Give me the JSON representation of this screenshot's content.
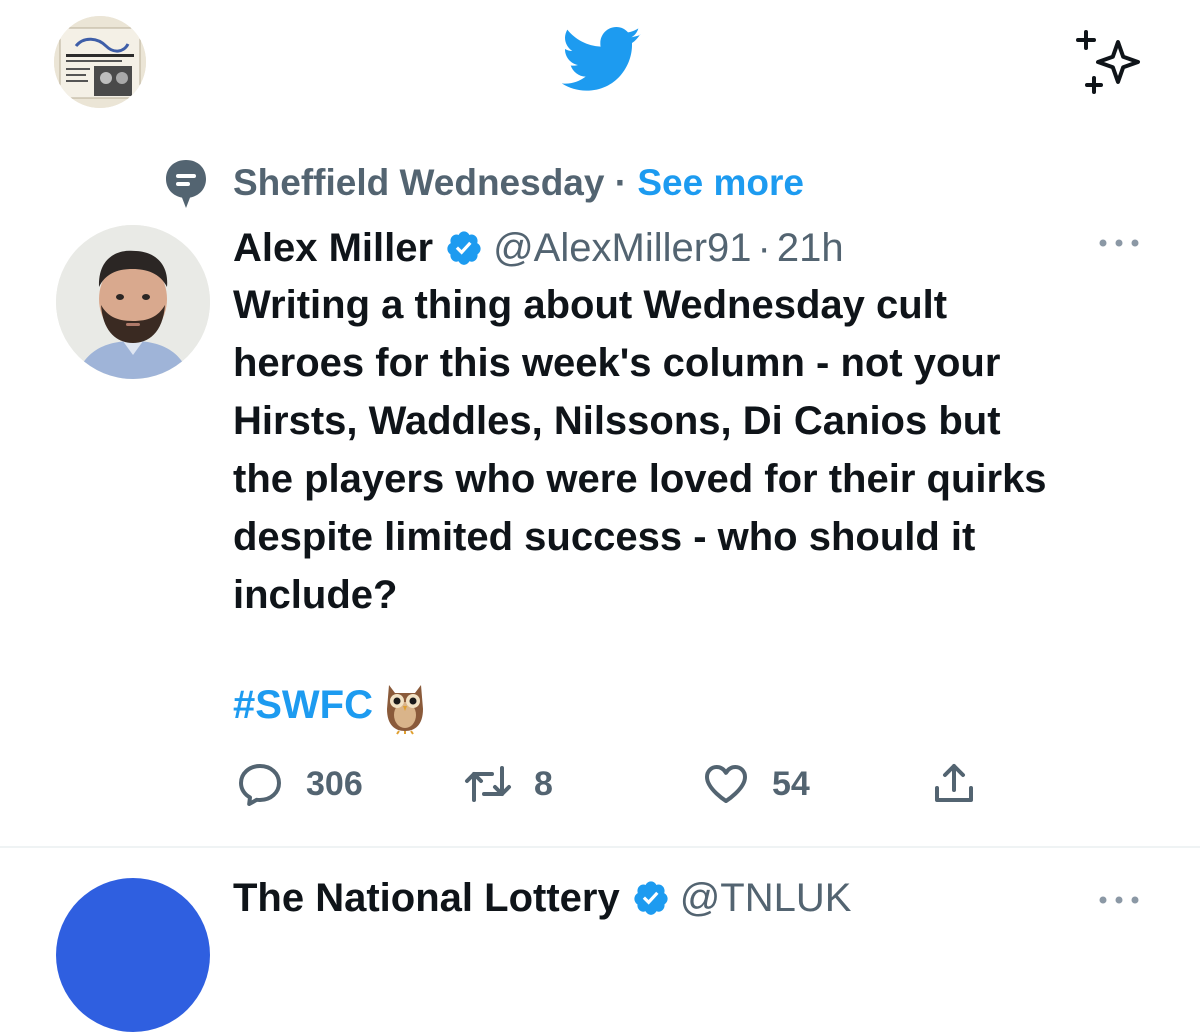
{
  "header": {
    "profile_icon": "user-profile-thumbnail",
    "logo_icon": "twitter-bird-icon",
    "timeline_icon": "sparkle-icon"
  },
  "context": {
    "topic": "Sheffield Wednesday",
    "separator": "·",
    "link": "See more"
  },
  "tweet": {
    "author_name": "Alex Miller",
    "handle": "@AlexMiller91",
    "separator": "·",
    "time": "21h",
    "text": "Writing a thing about Wednesday cult\nheroes for this week's column - not your\nHirsts, Waddles, Nilssons, Di Canios but\nthe players who were loved for their quirks\ndespite limited success - who should it\ninclude?",
    "hashtag": "#SWFC",
    "emoji": "owl-emoji",
    "replies": "306",
    "retweets": "8",
    "likes": "54"
  },
  "next_tweet": {
    "author_name": "The National Lottery",
    "handle": "@TNLUK"
  },
  "colors": {
    "accent": "#1d9bf0",
    "secondary_text": "#536471",
    "primary_text": "#0f1419"
  }
}
